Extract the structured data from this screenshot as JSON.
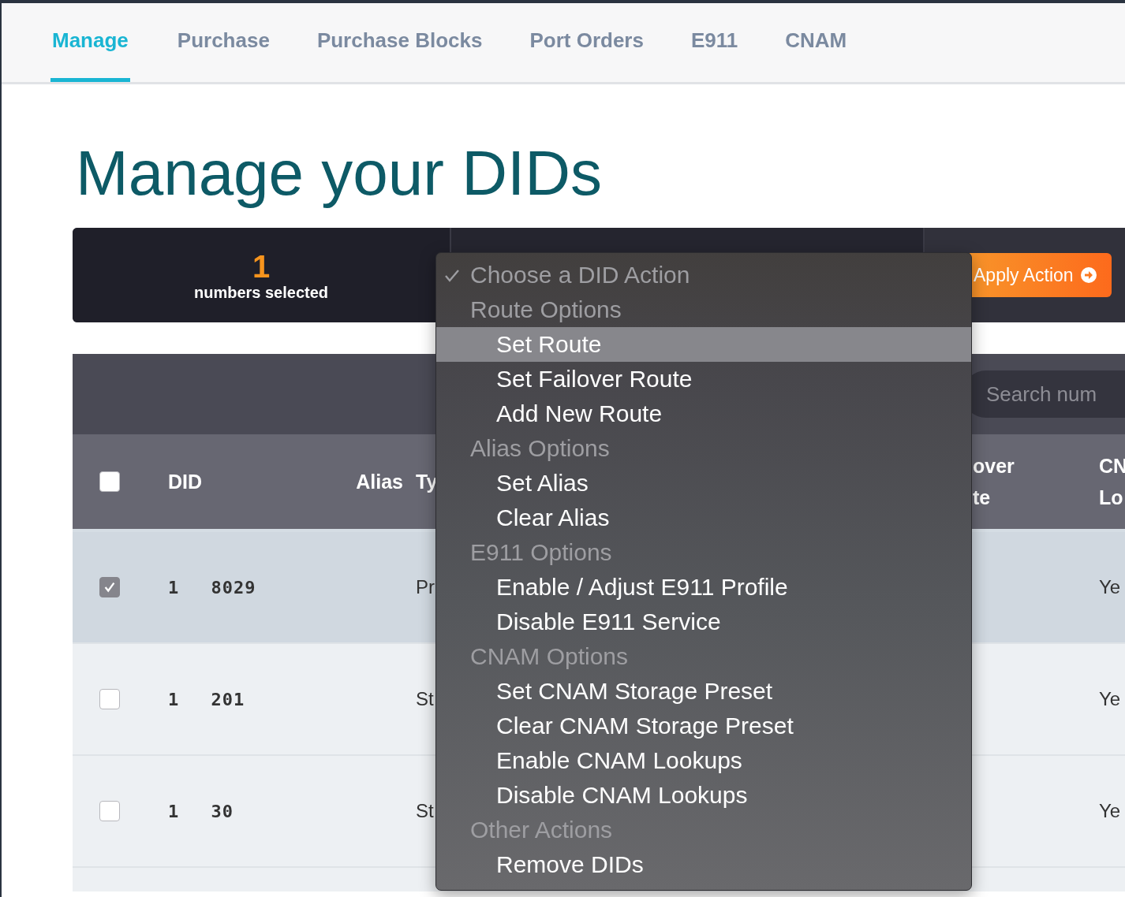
{
  "tabs": [
    {
      "label": "Manage",
      "selected": true
    },
    {
      "label": "Purchase",
      "selected": false
    },
    {
      "label": "Purchase Blocks",
      "selected": false
    },
    {
      "label": "Port Orders",
      "selected": false
    },
    {
      "label": "E911",
      "selected": false
    },
    {
      "label": "CNAM",
      "selected": false
    }
  ],
  "title": "Manage your DIDs",
  "action_bar": {
    "count": "1",
    "count_label": "numbers selected",
    "apply_button": "Apply Action"
  },
  "search": {
    "placeholder": "Search num"
  },
  "table": {
    "select_all": {
      "checked": false
    },
    "columns": [
      {
        "lines": [
          "DID"
        ]
      },
      {
        "lines": [
          "Alias"
        ]
      },
      {
        "lines": [
          "Ty"
        ]
      },
      {
        "lines": [
          "over",
          "te"
        ]
      },
      {
        "lines": [
          "CN",
          "Lo"
        ]
      }
    ],
    "rows": [
      {
        "checked": true,
        "did": "1 8029",
        "type": "Pr",
        "column_5": "Ye"
      },
      {
        "checked": false,
        "did": "1 201",
        "type": "St",
        "column_5": "Ye"
      },
      {
        "checked": false,
        "did": "1 30",
        "type": "St",
        "column_5": "Ye"
      }
    ]
  },
  "action_menu": {
    "items": [
      {
        "kind": "placeholder",
        "label": "Choose a DID Action",
        "checked": true
      },
      {
        "kind": "group",
        "label": "Route Options"
      },
      {
        "kind": "option",
        "label": "Set Route",
        "highlighted": true
      },
      {
        "kind": "option",
        "label": "Set Failover Route",
        "highlighted": false
      },
      {
        "kind": "option",
        "label": "Add New Route",
        "highlighted": false
      },
      {
        "kind": "group",
        "label": "Alias Options"
      },
      {
        "kind": "option",
        "label": "Set Alias",
        "highlighted": false
      },
      {
        "kind": "option",
        "label": "Clear Alias",
        "highlighted": false
      },
      {
        "kind": "group",
        "label": "E911 Options"
      },
      {
        "kind": "option",
        "label": "Enable / Adjust E911 Profile",
        "highlighted": false
      },
      {
        "kind": "option",
        "label": "Disable E911 Service",
        "highlighted": false
      },
      {
        "kind": "group",
        "label": "CNAM Options"
      },
      {
        "kind": "option",
        "label": "Set CNAM Storage Preset",
        "highlighted": false
      },
      {
        "kind": "option",
        "label": "Clear CNAM Storage Preset",
        "highlighted": false
      },
      {
        "kind": "option",
        "label": "Enable CNAM Lookups",
        "highlighted": false
      },
      {
        "kind": "option",
        "label": "Disable CNAM Lookups",
        "highlighted": false
      },
      {
        "kind": "group",
        "label": "Other Actions"
      },
      {
        "kind": "option",
        "label": "Remove DIDs",
        "highlighted": false
      }
    ]
  }
}
